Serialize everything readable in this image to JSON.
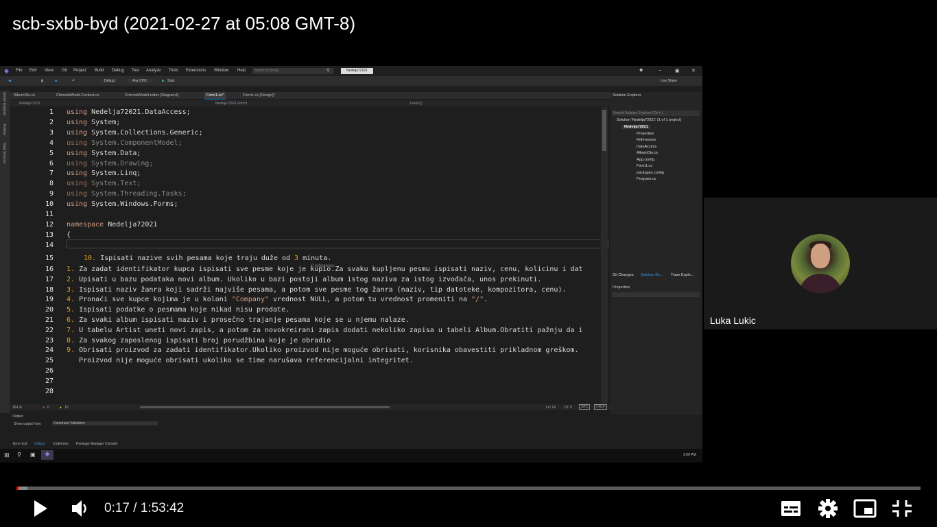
{
  "video_title": "scb-sxbb-byd (2021-02-27 at 05:08 GMT-8)",
  "vs": {
    "menu": [
      "File",
      "Edit",
      "View",
      "Git",
      "Project",
      "Build",
      "Debug",
      "Test",
      "Analyze",
      "Tools",
      "Extensions",
      "Window",
      "Help"
    ],
    "search_placeholder": "Search (Ctrl+Q)",
    "project_badge": "Nedelja72021",
    "toolbar": {
      "config": "Debug",
      "platform": "Any CPU",
      "start": "Start",
      "live_share": "Live Share"
    },
    "side_tabs": [
      "Server Explorer",
      "Toolbox",
      "Data Sources"
    ],
    "doc_tabs": [
      "AlbumDto.cs",
      "ChinookModel.Context.cs",
      "ChinookModel.edmx [Diagram1]",
      "Form1.cs*",
      "Form1.cs [Design]*"
    ],
    "nav": {
      "project": "Nedelja72021",
      "class": "Nedelja72021.Form1",
      "member": "Form1()"
    },
    "code_lines": [
      {
        "n": "1",
        "kw": "using",
        "rest": " Nedelja72021.DataAccess;",
        "style": "on"
      },
      {
        "n": "2",
        "kw": "using",
        "rest": " System;",
        "style": "on"
      },
      {
        "n": "3",
        "kw": "using",
        "rest": " System.Collections.Generic;",
        "style": "on"
      },
      {
        "n": "4",
        "kw": "using",
        "rest": " System.ComponentModel;",
        "style": "dim"
      },
      {
        "n": "5",
        "kw": "using",
        "rest": " System.Data;",
        "style": "on"
      },
      {
        "n": "6",
        "kw": "using",
        "rest": " System.Drawing;",
        "style": "dim"
      },
      {
        "n": "7",
        "kw": "using",
        "rest": " System.Linq;",
        "style": "on"
      },
      {
        "n": "8",
        "kw": "using",
        "rest": " System.Text;",
        "style": "dim"
      },
      {
        "n": "9",
        "kw": "using",
        "rest": " System.Threading.Tasks;",
        "style": "dim"
      },
      {
        "n": "10",
        "kw": "using",
        "rest": " System.Windows.Forms;",
        "style": "on"
      },
      {
        "n": "11",
        "kw": "",
        "rest": "",
        "style": "on"
      },
      {
        "n": "12",
        "kw": "namespace",
        "rest": " Nedelja72021",
        "style": "on"
      },
      {
        "n": "13",
        "kw": "",
        "rest": "{",
        "style": "on"
      },
      {
        "n": "14",
        "kw": "",
        "rest": "",
        "style": "on"
      },
      {
        "n": "15",
        "kw": "",
        "rest": "",
        "style": "on"
      }
    ],
    "line15": {
      "num": "10.",
      "text_a": " Ispisati nazive svih pesama koje traju duže od ",
      "num_mid": "3",
      "text_b": " minuta."
    },
    "references_hint": "0 references",
    "task_lines": [
      {
        "n": "16",
        "num": "1.",
        "text": " Za zadat identifikator kupca ispisati sve pesme koje je kupio.Za svaku kupljenu pesmu ispisati naziv, cenu, kolicinu i dat"
      },
      {
        "n": "17",
        "num": "2.",
        "text": " Upisati u bazu podataka novi album. Ukoliko u bazi postoji album istog naziva za istog izvođača, unos prekinuti."
      },
      {
        "n": "18",
        "num": "3.",
        "text": " Ispisati naziv žanra koji sadrži najviše pesama, a potom sve pesme tog žanra (naziv, tip datoteke, kompozitora, cenu)."
      },
      {
        "n": "19",
        "num": "4.",
        "text": " Pronaći sve kupce kojima je u koloni ",
        "str": "\"Company\"",
        "text2": " vrednost NULL, a potom tu vrednost promeniti na ",
        "str2": "\"/\"",
        "text3": "."
      },
      {
        "n": "20",
        "num": "5.",
        "text": " Ispisati podatke o pesmama koje nikad nisu prodate."
      },
      {
        "n": "21",
        "num": "6.",
        "text": " Za svaki album ispisati naziv i prosečno trajanje pesama koje se u njemu nalaze."
      },
      {
        "n": "22",
        "num": "7.",
        "text": " U tabelu Artist uneti novi zapis, a potom za novokreirani zapis dodati nekoliko zapisa u tabeli Album.Obratiti pažnju da i"
      },
      {
        "n": "23",
        "num": "8.",
        "text": " Za svakog zaposlenog ispisati broj porudžbina koje je obradio"
      },
      {
        "n": "24",
        "num": "9.",
        "text": " Obrisati proizvod za zadati identifikator.Ukoliko proizvod nije moguće obrisati, korisnika obavestiti prikladnom greškom."
      },
      {
        "n": "25",
        "num": "",
        "text": "   Proizvod nije moguće obrisati ukoliko se time narušava referencijalni integritet."
      },
      {
        "n": "26",
        "num": "",
        "text": ""
      },
      {
        "n": "27",
        "num": "",
        "text": ""
      },
      {
        "n": "28",
        "num": "",
        "text": ""
      }
    ],
    "status": {
      "zoom": "164 %",
      "errors": "0",
      "warnings": "10",
      "ln": "Ln: 14",
      "ch": "Ch: 5",
      "spc": "SPC",
      "crlf": "CRLF"
    },
    "output": {
      "title": "Output",
      "show_from": "Show output from:",
      "source": "Constraint Validation"
    },
    "bottom_tabs": [
      "Error List",
      "Output",
      "CodeLens",
      "Package Manager Console"
    ],
    "clock": "2:09 PM",
    "solution": {
      "title": "Solution Explorer",
      "search": "Search Solution Explorer (Ctrl+;)",
      "root": "Solution 'Nedelja72021' (1 of 1 project)",
      "project": "Nedelja72021",
      "items": [
        "Properties",
        "References",
        "DataAccess",
        "AlbumDto.cs",
        "App.config",
        "Form1.cs",
        "packages.config",
        "Program.cs"
      ],
      "tabs": [
        "Git Changes",
        "Solution Ex...",
        "Team Explo..."
      ]
    },
    "properties_title": "Properties"
  },
  "webcam": {
    "name": "Luka Lukic"
  },
  "player": {
    "current_time": "0:17",
    "duration": "1:53:42",
    "progress_fraction": 0.0025,
    "buffered_fraction": 0.012,
    "colors": {
      "progress": "#ff0000",
      "track": "#5a5a5a"
    },
    "icons": [
      "play-icon",
      "volume-icon",
      "subtitles-icon",
      "settings-icon",
      "miniplayer-icon",
      "exit-fullscreen-icon"
    ]
  }
}
